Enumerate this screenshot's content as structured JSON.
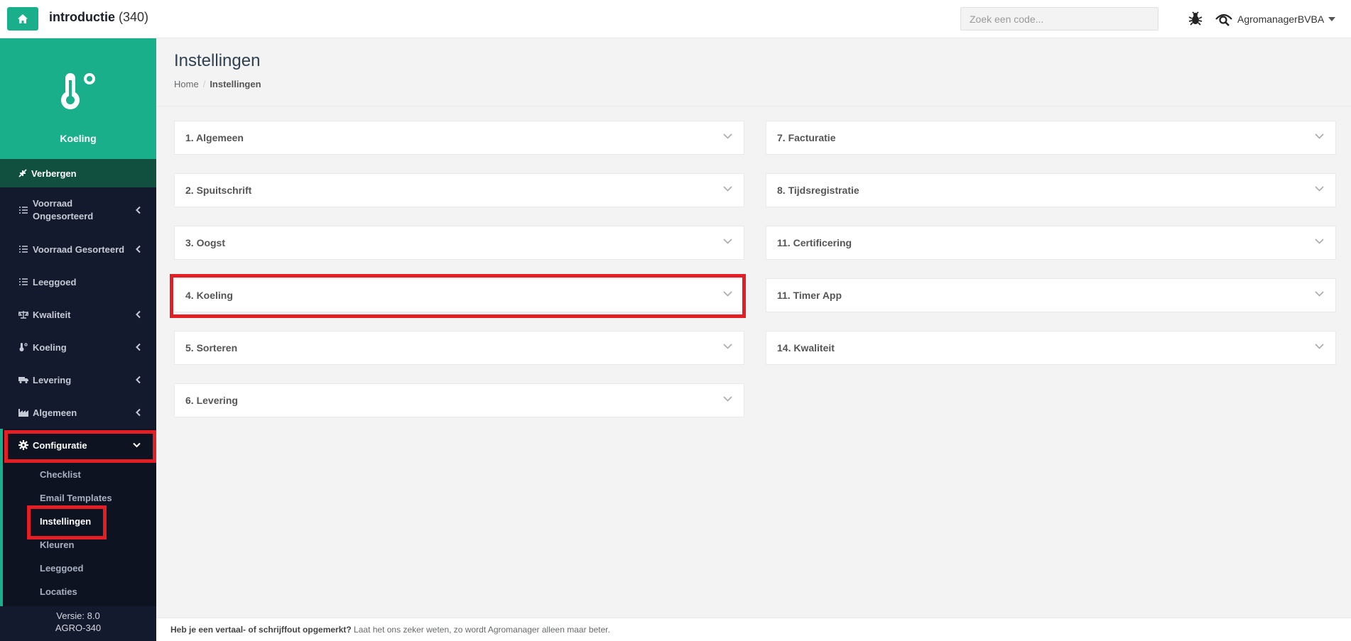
{
  "header": {
    "title": "introductie",
    "count": "(340)",
    "search_placeholder": "Zoek een code...",
    "username": "AgromanagerBVBA"
  },
  "sidebar": {
    "module_title": "Koeling",
    "hide_label": "Verbergen",
    "items": [
      {
        "label_line1": "Voorraad",
        "label_line2": "Ongesorteerd",
        "icon": "list-icon"
      },
      {
        "label": "Voorraad Gesorteerd",
        "icon": "list-icon"
      },
      {
        "label": "Leeggoed",
        "icon": "list-icon"
      },
      {
        "label": "Kwaliteit",
        "icon": "balance-scale-icon"
      },
      {
        "label": "Koeling",
        "icon": "thermometer-icon"
      },
      {
        "label": "Levering",
        "icon": "truck-icon"
      },
      {
        "label": "Algemeen",
        "icon": "industry-icon"
      },
      {
        "label": "Configuratie",
        "icon": "gear-icon"
      }
    ],
    "submenu": [
      "Checklist",
      "Email Templates",
      "Instellingen",
      "Kleuren",
      "Leeggoed",
      "Locaties"
    ],
    "version": "Versie: 8.0",
    "build": "AGRO-340"
  },
  "page": {
    "title": "Instellingen",
    "breadcrumb_home": "Home",
    "breadcrumb_current": "Instellingen"
  },
  "panels_left": [
    "1. Algemeen",
    "2. Spuitschrift",
    "3. Oogst",
    "4. Koeling",
    "5. Sorteren",
    "6. Levering"
  ],
  "panels_right": [
    "7. Facturatie",
    "8. Tijdsregistratie",
    "11. Certificering",
    "11. Timer App",
    "14. Kwaliteit"
  ],
  "footer": {
    "bold": "Heb je een vertaal- of schrijffout opgemerkt?",
    "text": " Laat het ons zeker weten, zo wordt Agromanager alleen maar beter."
  },
  "colors": {
    "accent": "#1aaf8b",
    "sidebar_bg": "#141a2e",
    "highlight": "#e31e24"
  }
}
